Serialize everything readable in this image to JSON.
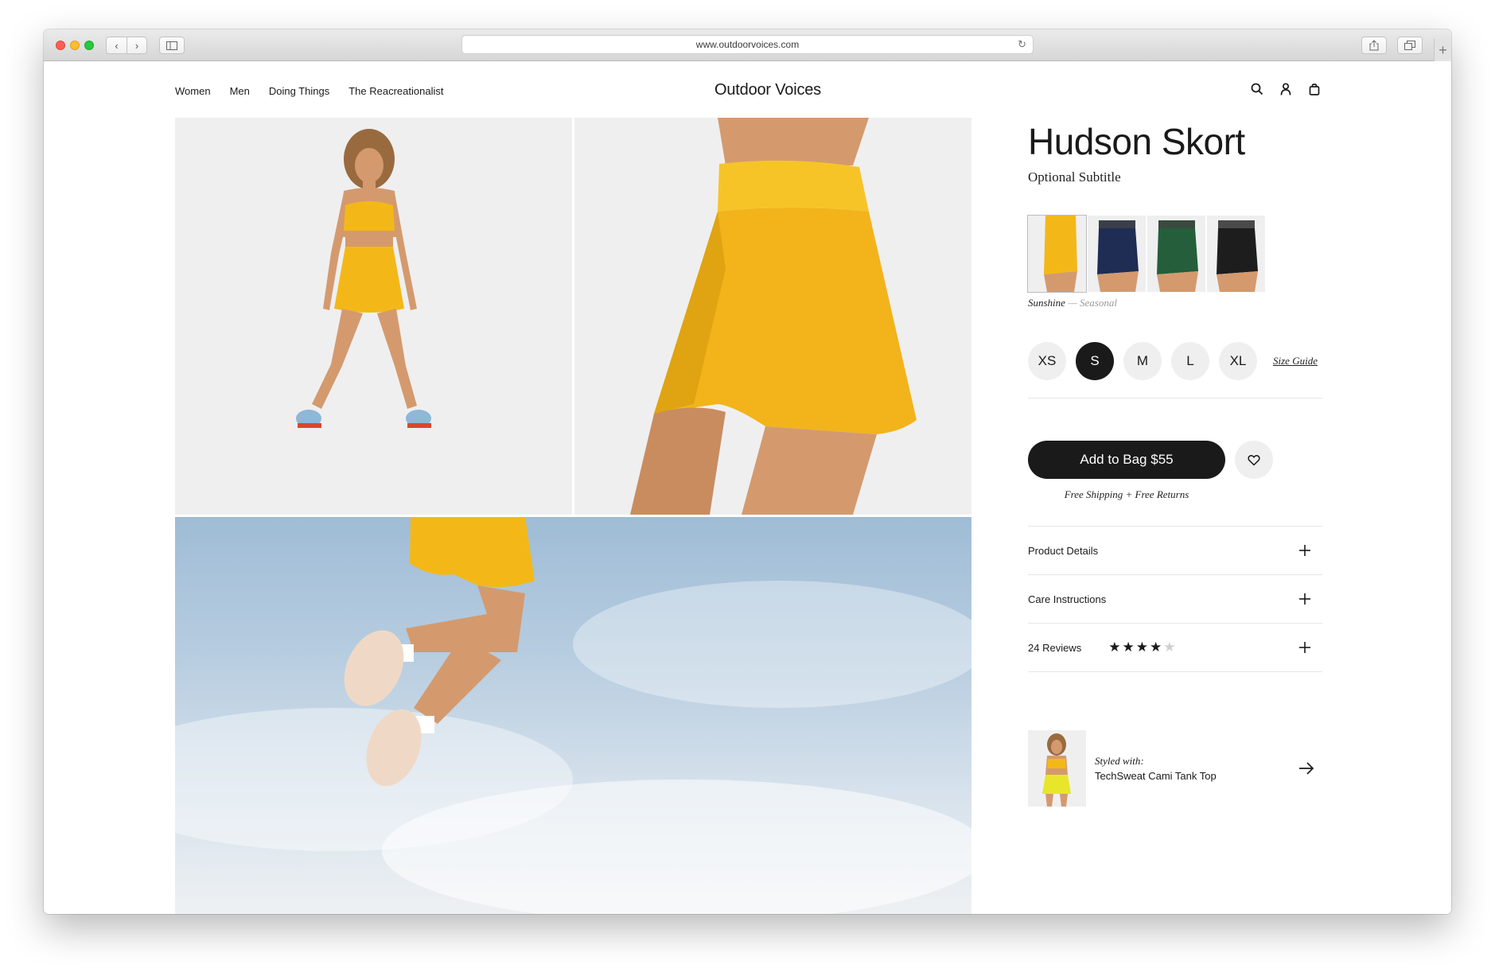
{
  "browser": {
    "url": "www.outdoorvoices.com"
  },
  "header": {
    "nav": [
      "Women",
      "Men",
      "Doing Things",
      "The Reacreationalist"
    ],
    "brand": "Outdoor Voices",
    "icons": [
      "search-icon",
      "account-icon",
      "bag-icon"
    ]
  },
  "product": {
    "title": "Hudson Skort",
    "subtitle": "Optional Subtitle",
    "swatches": [
      {
        "name": "Sunshine",
        "color": "#f3b818"
      },
      {
        "name": "Navy",
        "color": "#1f2d55"
      },
      {
        "name": "Green",
        "color": "#245e3b"
      },
      {
        "name": "Black",
        "color": "#1d1d1d"
      }
    ],
    "color_name": "Sunshine",
    "color_separator": "—",
    "color_tag": "Seasonal",
    "sizes": [
      "XS",
      "S",
      "M",
      "L",
      "XL"
    ],
    "selected_size": "S",
    "size_guide": "Size Guide",
    "add_to_bag": "Add to Bag $55",
    "shipping": "Free Shipping + Free Returns"
  },
  "accordion": {
    "product_details": "Product Details",
    "care_instructions": "Care Instructions",
    "reviews": "24 Reviews",
    "rating": 4,
    "rating_max": 5
  },
  "styled_with": {
    "label": "Styled with:",
    "name": "TechSweat Cami Tank Top"
  },
  "colors": {
    "accent": "#f3b818",
    "dark": "#1a1a1a",
    "light_bg": "#efeff0"
  }
}
